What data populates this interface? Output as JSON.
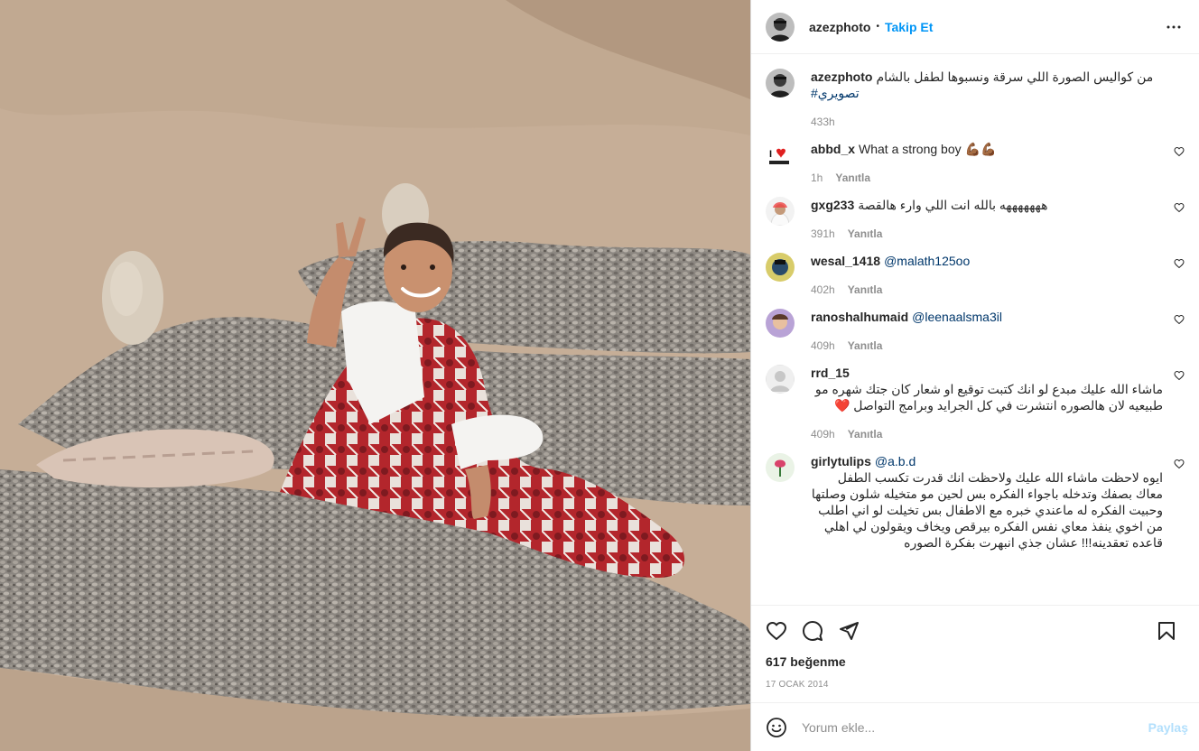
{
  "post": {
    "username": "azezphoto",
    "dot": "•",
    "follow_label": "Takip Et",
    "more_icon": "more-horizontal-icon"
  },
  "caption": {
    "username": "azezphoto",
    "text": "من كواليس الصورة اللي سرقة ونسبوها لطفل بالشام",
    "hashtag": "#تصويري",
    "time": "433h"
  },
  "comments": [
    {
      "username": "abbd_x",
      "text": "What a strong boy 💪🏾💪🏾",
      "time": "1h",
      "reply": "Yanıtla"
    },
    {
      "username": "gxg233",
      "text": "هههههههه بالله انت اللي وارء هالقصة",
      "time": "391h",
      "reply": "Yanıtla"
    },
    {
      "username": "wesal_1418",
      "mention": "@malath125oo",
      "time": "402h",
      "reply": "Yanıtla"
    },
    {
      "username": "ranoshalhumaid",
      "mention": "@leenaalsma3il",
      "time": "409h",
      "reply": "Yanıtla"
    },
    {
      "username": "rrd_15",
      "text": "ماشاء الله عليك مبدع لو انك كتبت توقيع او شعار كان جتك شهره مو طبيعيه لان هالصوره انتشرت في كل الجرايد وبرامج التواصل ❤️",
      "time": "409h",
      "reply": "Yanıtla"
    },
    {
      "username": "girlytulips",
      "mention": "@a.b.d",
      "text": "ايوه لاحظت ماشاء الله عليك ولاحظت انك قدرت تكسب الطفل معاك بصفك وتدخله باجواء الفكره بس لحين مو متخيله شلون وصلتها وحبيت الفكره له ماعندي خبره مع الاطفال بس تخيلت لو اني اطلب من اخوي ينفذ معاي نفس الفكره بيرقص ويخاف ويقولون لي اهلي قاعده تعقدينه!!! عشان جذي انبهرت بفكرة الصوره",
      "time": "",
      "reply": ""
    }
  ],
  "actions": {
    "like_icon": "heart-icon",
    "comment_icon": "comment-icon",
    "share_icon": "send-icon",
    "save_icon": "bookmark-icon",
    "likes": "617 beğenme",
    "date": "17 OCAK 2014"
  },
  "add_comment": {
    "placeholder": "Yorum ekle...",
    "post_label": "Paylaş",
    "emoji_icon": "emoji-icon"
  },
  "colors": {
    "accent": "#0095f6",
    "text": "#262626",
    "muted": "#8e8e8e"
  }
}
